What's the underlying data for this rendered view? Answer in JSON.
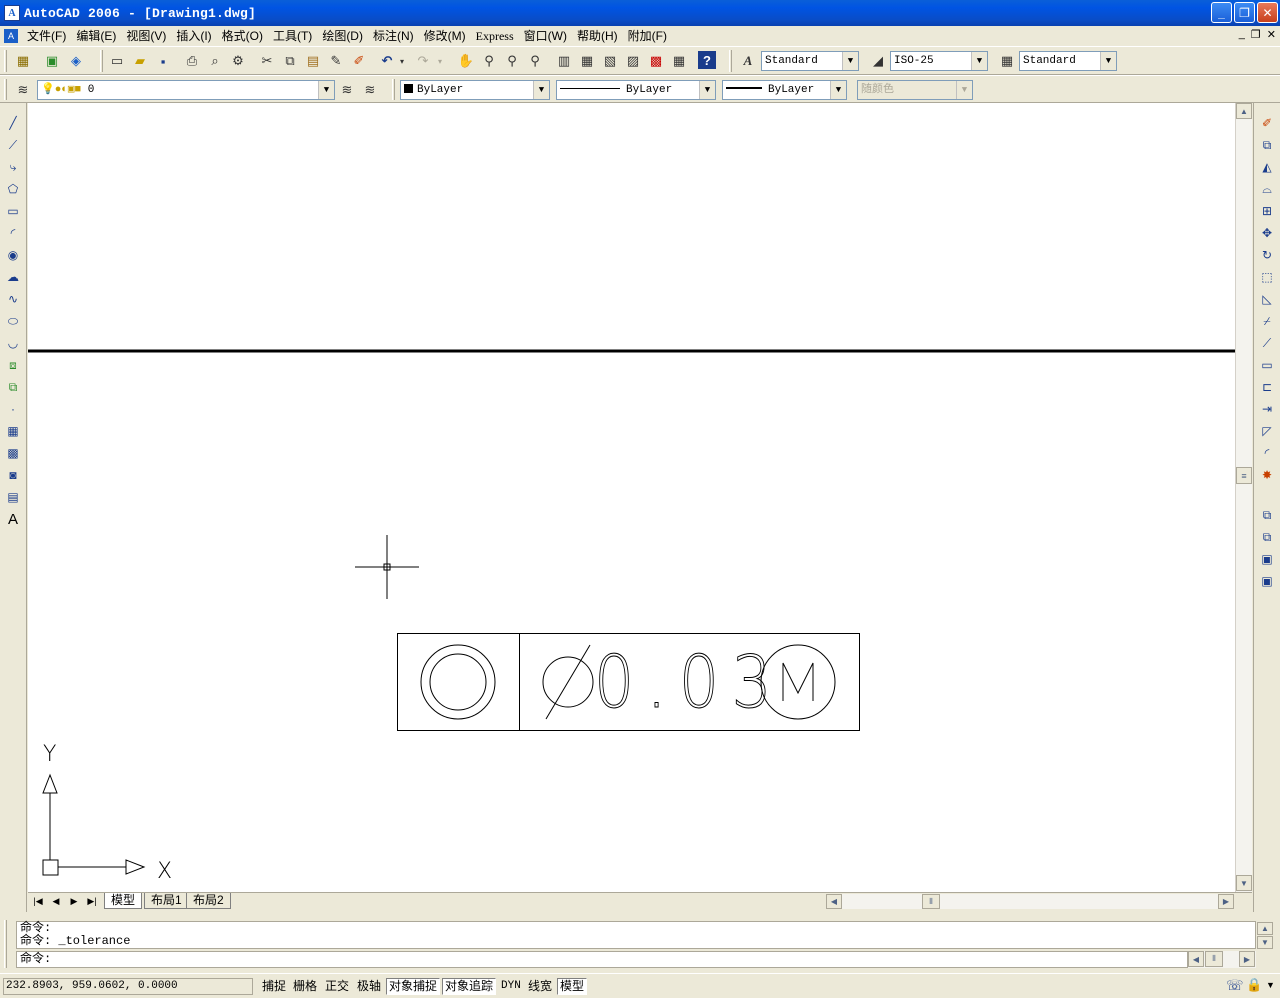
{
  "window": {
    "title": "AutoCAD 2006 - [Drawing1.dwg]",
    "app_icon": "A"
  },
  "menu": [
    "文件(F)",
    "编辑(E)",
    "视图(V)",
    "插入(I)",
    "格式(O)",
    "工具(T)",
    "绘图(D)",
    "标注(N)",
    "修改(M)",
    "Express",
    "窗口(W)",
    "帮助(H)",
    "附加(F)"
  ],
  "styles": {
    "text_style": "Standard",
    "dim_style": "ISO-25",
    "table_style": "Standard"
  },
  "layers": {
    "current": "0",
    "color": "ByLayer",
    "linetype": "ByLayer",
    "lineweight": "ByLayer",
    "plotstyle": "随颜色"
  },
  "drawing": {
    "tolerance": {
      "value": "0.03"
    },
    "ucs": {
      "x_label": "X",
      "y_label": "Y"
    }
  },
  "tabs": [
    "模型",
    "布局1",
    "布局2"
  ],
  "command": {
    "history": [
      "命令:",
      "命令: _tolerance"
    ],
    "prompt": "命令:"
  },
  "status": {
    "coords": "232.8903, 959.0602, 0.0000",
    "buttons": [
      {
        "label": "捕捉",
        "on": false
      },
      {
        "label": "栅格",
        "on": false
      },
      {
        "label": "正交",
        "on": false
      },
      {
        "label": "极轴",
        "on": false
      },
      {
        "label": "对象捕捉",
        "on": true
      },
      {
        "label": "对象追踪",
        "on": true
      },
      {
        "label": "DYN",
        "on": false
      },
      {
        "label": "线宽",
        "on": false
      },
      {
        "label": "模型",
        "on": true
      }
    ]
  },
  "colors": {
    "titlebar": "#0054e3",
    "chrome": "#ece9d8",
    "canvas": "#ffffff"
  }
}
